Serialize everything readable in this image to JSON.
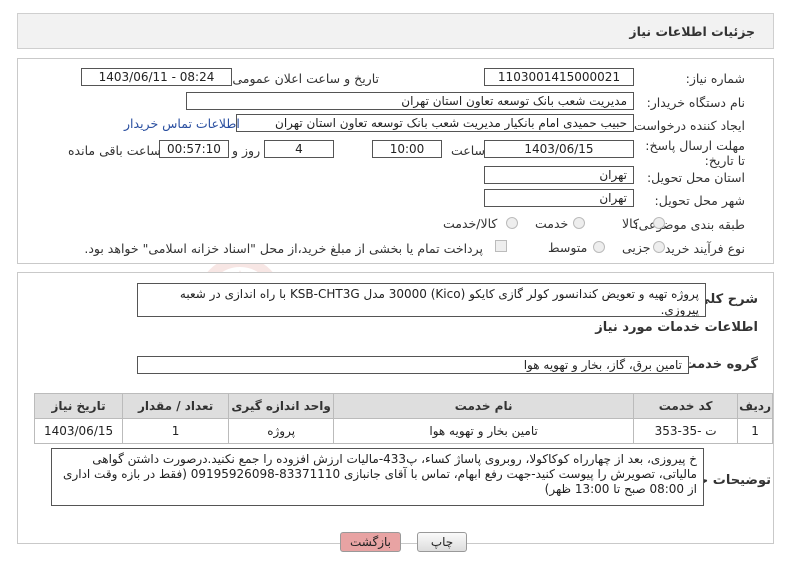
{
  "header": {
    "title": "جزئیات اطلاعات نیاز"
  },
  "form": {
    "need_number_label": "شماره نیاز:",
    "need_number": "1103001415000021",
    "announce_label": "تاریخ و ساعت اعلان عمومی:",
    "announce_value": "1403/06/11 - 08:24",
    "buyer_org_label": "نام دستگاه خریدار:",
    "buyer_org": "مدیریت شعب بانک توسعه تعاون استان تهران",
    "creator_label": "ایجاد کننده درخواست:",
    "creator": "حبیب حمیدی امام بانکیار مدیریت شعب بانک توسعه تعاون استان تهران",
    "contact_link": "اطلاعات تماس خریدار",
    "deadline_label": "مهلت ارسال پاسخ: تا تاریخ:",
    "deadline_date": "1403/06/15",
    "time_label": "ساعت",
    "deadline_time": "10:00",
    "days_value": "4",
    "days_label": "روز و",
    "remaining_time": "00:57:10",
    "remaining_label": "ساعت باقی مانده",
    "province_label": "استان محل تحویل:",
    "province": "تهران",
    "city_label": "شهر محل تحویل:",
    "city": "تهران",
    "category_label": "طبقه بندی موضوعی:",
    "category_options": [
      "کالا",
      "خدمت",
      "کالا/خدمت"
    ],
    "process_label": "نوع فرآیند خرید :",
    "process_options": [
      "جزیی",
      "متوسط"
    ],
    "payment_note": "پرداخت تمام یا بخشی از مبلغ خرید،از محل \"اسناد خزانه اسلامی\" خواهد بود."
  },
  "summary": {
    "label": "شرح کلی نیاز:",
    "text": "پروژه تهیه و تعویض کندانسور کولر گازی کایکو (Kico) 30000 مدل KSB-CHT3G  با راه اندازی در شعبه پیروزی."
  },
  "services": {
    "section_title": "اطلاعات خدمات مورد نیاز",
    "group_label": "گروه خدمت:",
    "group_value": "تامین برق، گاز، بخار و تهویه هوا",
    "columns": [
      "ردیف",
      "کد خدمت",
      "نام خدمت",
      "واحد اندازه گیری",
      "تعداد / مقدار",
      "تاریخ نیاز"
    ],
    "rows": [
      {
        "index": "1",
        "code": "ت -35-353",
        "name": "تامین بخار و تهویه هوا",
        "unit": "پروژه",
        "qty": "1",
        "date": "1403/06/15"
      }
    ]
  },
  "buyer_notes": {
    "label": "توضیحات خریدار:",
    "text": "خ پیروزی، بعد از چهارراه کوکاکولا، روبروی پاساژ کساء، پ433-مالیات ارزش افزوده را جمع نکنید.درصورت داشتن گواهی مالیاتی، تصویرش را پیوست کنید-جهت رفع ابهام، تماس با آقای جانبازی 83371110-09195926098 (فقط در بازه وقت اداری از 08:00 صبح تا 13:00 ظهر)"
  },
  "buttons": {
    "print": "چاپ",
    "back": "بازگشت"
  },
  "watermark": {
    "text": "AriaTender.net"
  },
  "colors": {
    "back_button_bg": "#e8a3a3",
    "link": "#2a4fa0",
    "watermark": "#c0392b"
  }
}
